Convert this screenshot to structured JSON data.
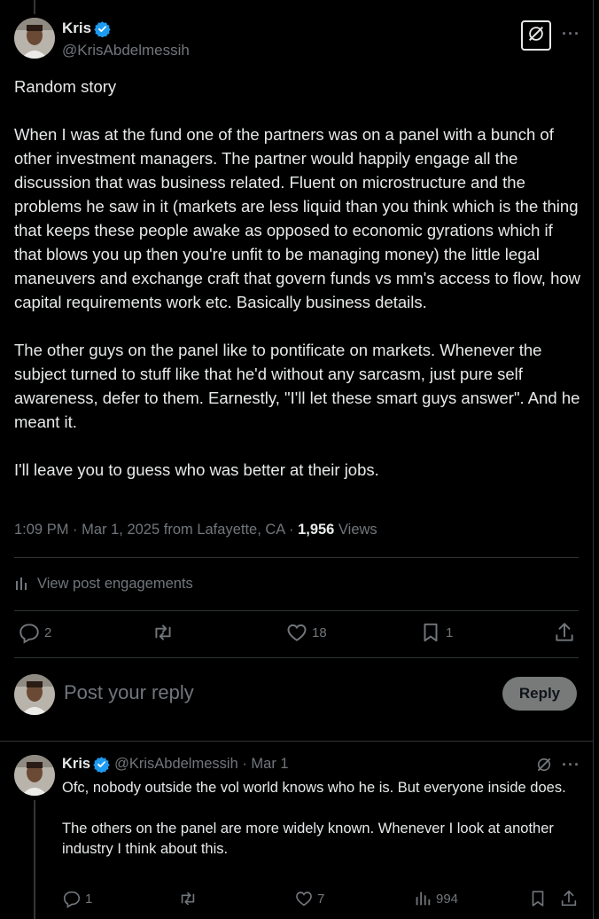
{
  "main_post": {
    "author_name": "Kris",
    "author_handle": "@KrisAbdelmessih",
    "body": "Random story\n\nWhen I was at the fund one of the partners was on a panel with a bunch of other investment managers. The partner would happily engage all the discussion that was business related. Fluent on microstructure and the problems he saw in it (markets are less liquid than you think which is the thing that keeps these people awake as opposed to economic gyrations which if that blows you up then you're unfit to be managing money) the little legal maneuvers and exchange craft that govern funds vs mm's access to flow, how capital requirements work etc. Basically business details.\n\nThe other guys on the panel like to pontificate on markets. Whenever the subject turned to stuff like that he'd without any sarcasm, just pure self awareness, defer to them. Earnestly, \"I'll let these smart guys answer\". And he meant it.\n\nI'll leave you to guess who was better at their jobs.",
    "timestamp": "1:09 PM · Mar 1, 2025 from Lafayette, CA · ",
    "views_count": "1,956",
    "views_label": " Views",
    "engagements_label": "View post engagements",
    "replies": "2",
    "reposts": "",
    "likes": "18",
    "bookmarks": "1"
  },
  "composer": {
    "placeholder": "Post your reply",
    "reply_button": "Reply"
  },
  "reply_post": {
    "author_name": "Kris",
    "author_handle": "@KrisAbdelmessih · Mar 1",
    "body": "Ofc, nobody outside the vol world knows who he is. But everyone inside does.\n\nThe others on the panel are more widely known. Whenever I look at another industry I think about this.",
    "replies": "1",
    "likes": "7",
    "views": "994"
  },
  "colors": {
    "background": "#000000",
    "text": "#e7e9ea",
    "muted": "#71767b",
    "verified": "#1d9bf0",
    "divider": "#2f3336"
  }
}
